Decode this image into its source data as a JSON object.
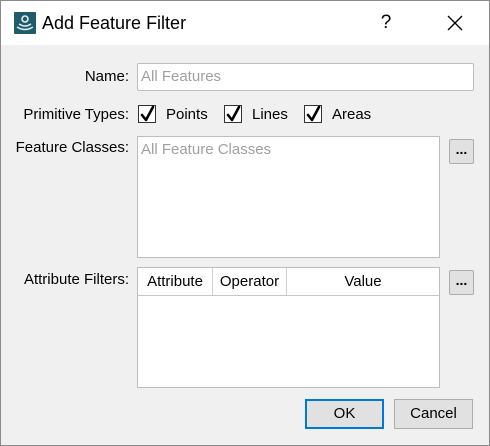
{
  "window": {
    "title": "Add Feature Filter",
    "help_label": "?"
  },
  "form": {
    "name_label": "Name:",
    "name_placeholder": "All Features",
    "primitive_types_label": "Primitive Types:",
    "primitive_types": [
      {
        "label": "Points",
        "checked": true
      },
      {
        "label": "Lines",
        "checked": true
      },
      {
        "label": "Areas",
        "checked": true
      }
    ],
    "feature_classes_label": "Feature Classes:",
    "feature_classes_placeholder": "All Feature Classes",
    "browse_label": "...",
    "attribute_filters_label": "Attribute Filters:",
    "attribute_columns": [
      "Attribute",
      "Operator",
      "Value"
    ]
  },
  "buttons": {
    "ok": "OK",
    "cancel": "Cancel"
  },
  "colors": {
    "accent": "#0078d7",
    "icon_bg": "#1f5b6b"
  }
}
